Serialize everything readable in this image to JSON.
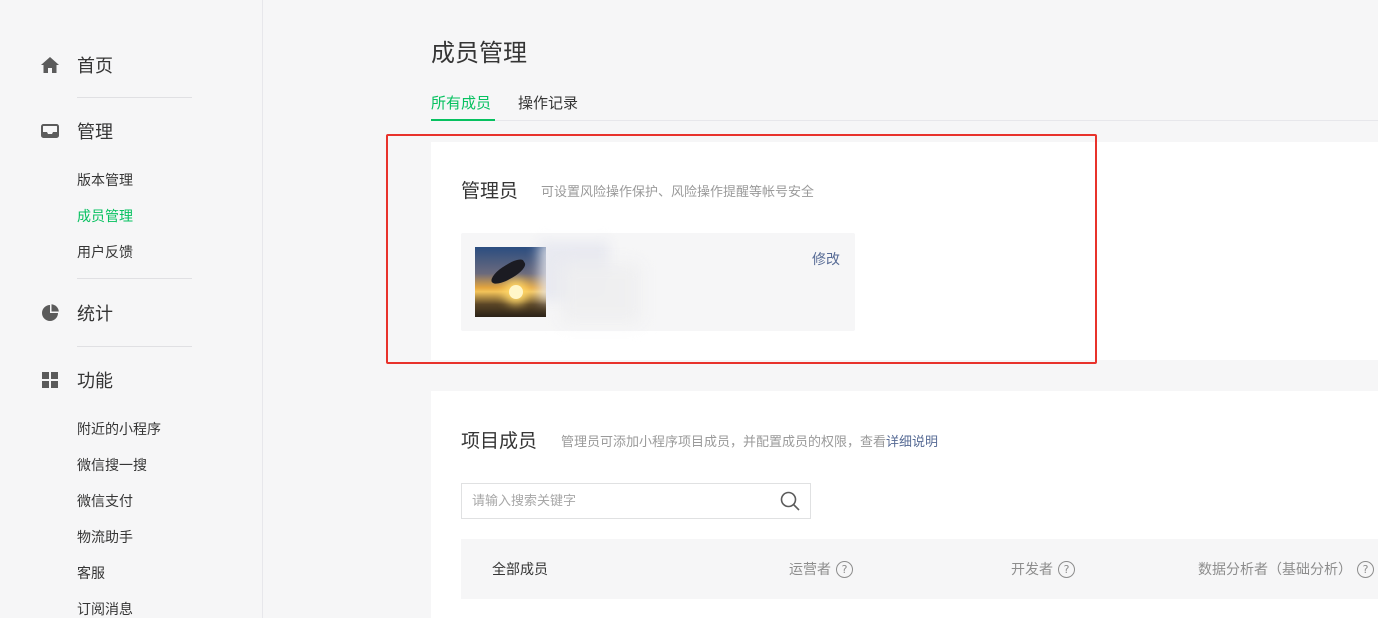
{
  "sidebar": {
    "home": {
      "label": "首页",
      "icon": "home-icon"
    },
    "manage": {
      "label": "管理",
      "icon": "inbox-icon",
      "items": [
        "版本管理",
        "成员管理",
        "用户反馈"
      ],
      "active": "成员管理"
    },
    "stats": {
      "label": "统计",
      "icon": "pie-chart-icon"
    },
    "features": {
      "label": "功能",
      "icon": "grid-icon",
      "items": [
        "附近的小程序",
        "微信搜一搜",
        "微信支付",
        "物流助手",
        "客服",
        "订阅消息"
      ]
    }
  },
  "main": {
    "title": "成员管理",
    "tabs": [
      {
        "label": "所有成员",
        "active": true
      },
      {
        "label": "操作记录",
        "active": false
      }
    ],
    "admin": {
      "title": "管理员",
      "desc": "可设置风险操作保护、风险操作提醒等帐号安全",
      "edit_label": "修改"
    },
    "members": {
      "title": "项目成员",
      "desc": "管理员可添加小程序项目成员，并配置成员的权限，查看",
      "desc_link": "详细说明",
      "search_placeholder": "请输入搜索关键字",
      "columns": [
        "全部成员",
        "运营者",
        "开发者",
        "数据分析者（基础分析）"
      ]
    }
  },
  "colors": {
    "accent": "#07c160",
    "link": "#576b95",
    "highlight": "#e8322b"
  }
}
